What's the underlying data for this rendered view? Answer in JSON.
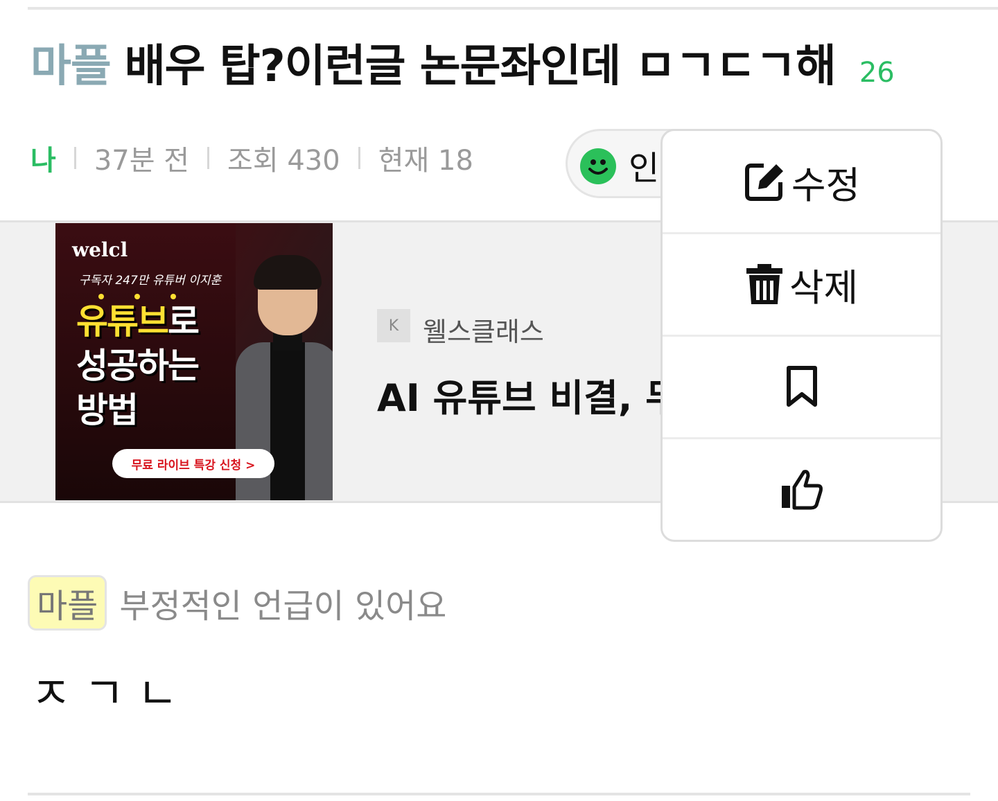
{
  "post": {
    "category": "마플",
    "title": "배우 탑?이런글 논문좌인데 ㅁㄱㄷㄱ해",
    "comment_count": "26",
    "author": "나",
    "time_ago": "37분 전",
    "views": "조회 430",
    "current": "현재 18",
    "like_pill_label": "인"
  },
  "ad": {
    "banner": {
      "logo": "welcl",
      "subtitle": "구독자 247만 유튜버 이지훈",
      "headline_yellow": "유튜브",
      "headline_rest1": "로",
      "headline_line2": "성공하는",
      "headline_line3": "방법",
      "cta": "무료 라이브 특강 신청 >"
    },
    "badge": "K",
    "brand": "웰스클래스",
    "title": "AI 유튜브 비결, 무"
  },
  "menu": {
    "edit_label": "수정",
    "delete_label": "삭제",
    "icons": [
      "edit-icon",
      "trash-icon",
      "bookmark-icon",
      "thumbs-up-icon"
    ]
  },
  "content": {
    "tag": "마플",
    "tag_note": "부정적인 언급이 있어요",
    "body": "ㅈㄱㄴ"
  },
  "colors": {
    "accent_green": "#2bbd63",
    "category_blue_gray": "#8aa9b3",
    "tag_yellow": "#fdfbb5"
  }
}
